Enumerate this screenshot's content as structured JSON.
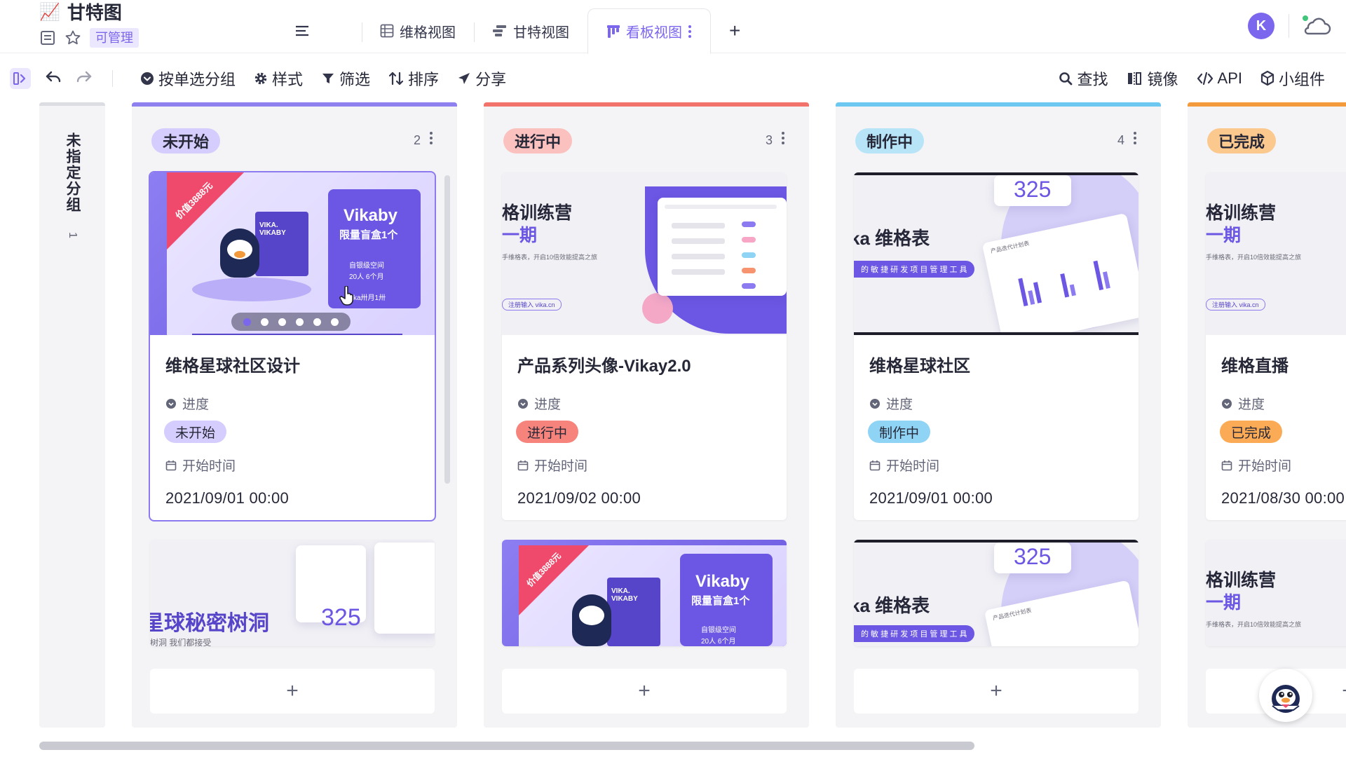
{
  "app": {
    "title": "甘特图",
    "title_emoji": "📈",
    "permission": "可管理"
  },
  "tabs": [
    {
      "label": "维格视图",
      "icon": "grid-view-icon"
    },
    {
      "label": "甘特视图",
      "icon": "gantt-view-icon"
    },
    {
      "label": "看板视图",
      "icon": "kanban-view-icon",
      "active": true
    }
  ],
  "header": {
    "avatar_initial": "K",
    "accent": "#7b67ee"
  },
  "toolbar": {
    "group_by": "按单选分组",
    "style": "样式",
    "filter": "筛选",
    "sort": "排序",
    "share": "分享",
    "search": "查找",
    "mirror": "镜像",
    "api": "API",
    "widget": "小组件"
  },
  "ungrouped": {
    "label": "未指定分组",
    "count": "1"
  },
  "columns": [
    {
      "name": "未开始",
      "count": "2",
      "bar_color": "#8f80f0",
      "tag_color": "#d5cdfd",
      "cards": [
        {
          "title": "维格星球社区设计",
          "field_label": "进度",
          "status": "未开始",
          "date_label": "开始时间",
          "date": "2021/09/01  00:00",
          "cover": {
            "badge": "价值3888元",
            "brand": "Vikaby",
            "line1": "限量盲盒1个",
            "line2": "自银级空间",
            "line3": "20人 6个月",
            "line4": "ka卅月1卅",
            "box": "VIKA. VIKABY"
          }
        }
      ],
      "peek": {
        "headline": "星球秘密树洞",
        "sub": "树洞 我们都接受",
        "number": "325"
      }
    },
    {
      "name": "进行中",
      "count": "3",
      "bar_color": "#f2736b",
      "tag_color": "#fbc1be",
      "cards": [
        {
          "title": "产品系列头像-Vikay2.0",
          "field_label": "进度",
          "status": "进行中",
          "date_label": "开始时间",
          "date": "2021/09/02  00:00",
          "cover": {
            "headline1": "格训练营",
            "headline2": "一期",
            "sub": "手维格表，开启10倍效能提高之旅",
            "link": "注册输入 vika.cn"
          }
        }
      ],
      "peek": {
        "badge": "价值3888元",
        "brand": "Vikaby",
        "line1": "限量盲盒1个",
        "line2": "自银级空间",
        "line3": "20人 6个月",
        "box": "VIKA. VIKABY"
      }
    },
    {
      "name": "制作中",
      "count": "4",
      "bar_color": "#6cc8f0",
      "tag_color": "#b8e4f8",
      "cards": [
        {
          "title": "维格星球社区",
          "field_label": "进度",
          "status": "制作中",
          "date_label": "开始时间",
          "date": "2021/09/01  00:00",
          "cover": {
            "headline": "ka 维格表",
            "ribbon": "的 敏 捷 研 发 项 目 管 理 工 具",
            "number": "325",
            "panel": "产品迭代计划表"
          }
        }
      ],
      "peek": {
        "headline": "ka 维格表",
        "ribbon": "的 敏 捷 研 发 项 目 管 理 工 具",
        "number": "325",
        "panel": "产品迭代计划表"
      }
    },
    {
      "name": "已完成",
      "count": "",
      "bar_color": "#f39a3c",
      "tag_color": "#fbc98e",
      "cards": [
        {
          "title": "维格直播",
          "field_label": "进度",
          "status": "已完成",
          "date_label": "开始时间",
          "date": "2021/08/30  00:00",
          "cover": {
            "headline1": "格训练营",
            "headline2": "一期",
            "sub": "手维格表，开启10倍效能提高之旅",
            "link": "注册输入 vika.cn"
          }
        }
      ],
      "peek": {
        "headline1": "格训练营",
        "headline2": "一期",
        "sub": "手维格表，开启10倍效能提高之旅"
      }
    }
  ]
}
